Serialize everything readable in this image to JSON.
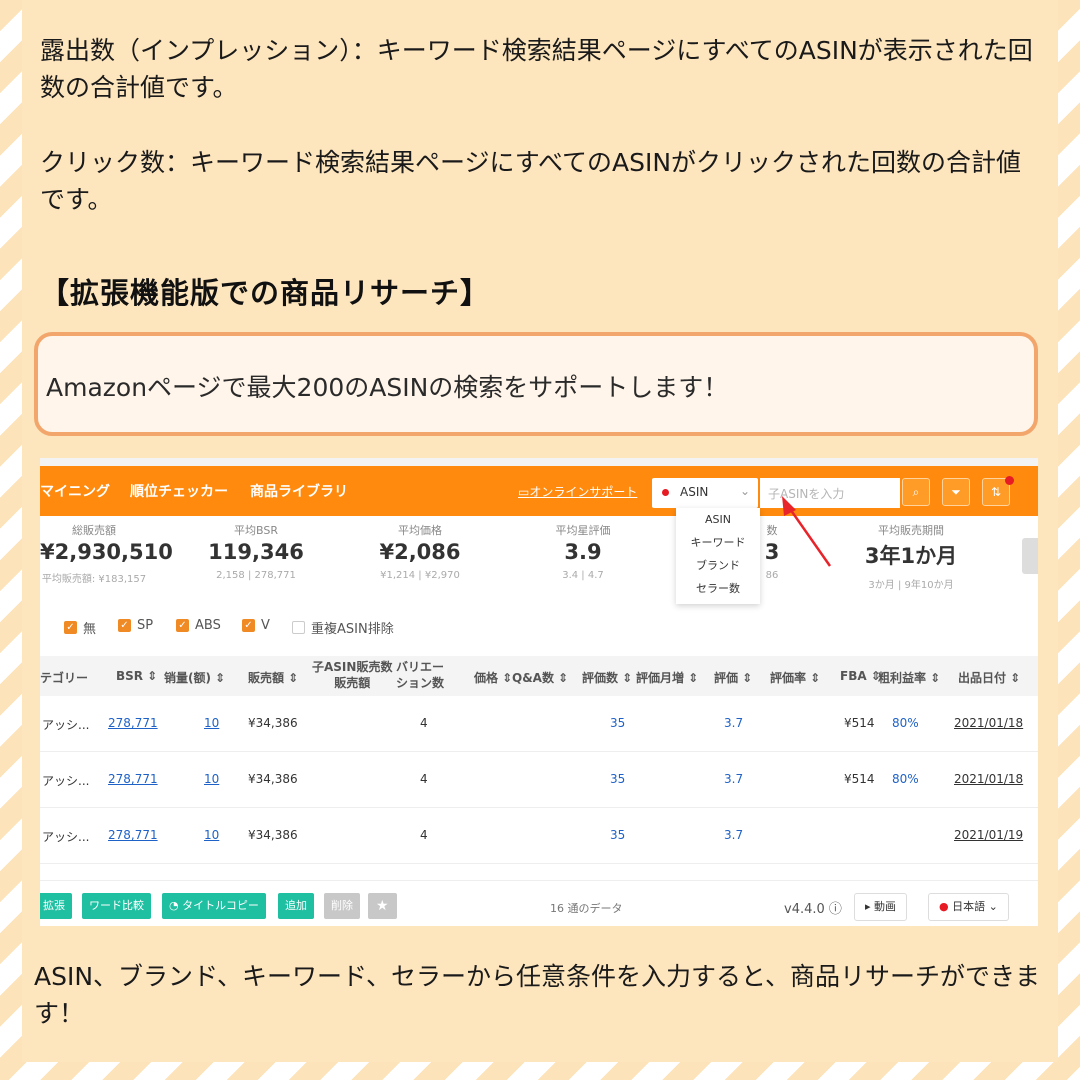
{
  "intro": {
    "impressions_text": "露出数（インプレッション）：キーワード検索結果ページにすべてのASINが表示された回数の合計値です。",
    "clicks_text": "クリック数：キーワード検索結果ページにすべてのASINがクリックされた回数の合計値です。"
  },
  "section_heading": "【拡張機能版での商品リサーチ】",
  "callout_text": "Amazonページで最大200のASINの検索をサポートします！",
  "closing_text": "ASIN、ブランド、キーワード、セラーから任意条件を入力すると、商品リサーチができます！",
  "screenshot": {
    "nav": {
      "tabs": [
        "マイニング",
        "順位チェッカー",
        "商品ライブラリ"
      ],
      "support_link": "オンラインサポート",
      "search_type": "ASIN",
      "search_placeholder": "子ASINを入力",
      "dropdown_options": [
        "ASIN",
        "キーワード",
        "ブランド",
        "セラー数"
      ]
    },
    "stats": [
      {
        "label": "総販売額",
        "value": "¥2,930,510",
        "sub": "平均販売額: ¥183,157"
      },
      {
        "label": "平均BSR",
        "value": "119,346",
        "sub": "2,158 | 278,771"
      },
      {
        "label": "平均価格",
        "value": "¥2,086",
        "sub": "¥1,214 | ¥2,970"
      },
      {
        "label": "平均星評価",
        "value": "3.9",
        "sub": "3.4 | 4.7"
      },
      {
        "label": "数",
        "value": "3",
        "sub": "86"
      },
      {
        "label": "平均販売期間",
        "value": "3年1か月",
        "sub": "3か月 | 9年10か月"
      }
    ],
    "filters": {
      "checked": [
        "無",
        "SP",
        "ABS",
        "V"
      ],
      "unchecked": "重複ASIN排除"
    },
    "columns": {
      "category": "テゴリー",
      "bsr": "BSR",
      "sales_qty": "销量(额)",
      "sales_amount": "販売額",
      "child_asin_1": "子ASIN販売数",
      "child_asin_2": "販売額",
      "variation_1": "バリエー",
      "variation_2": "ション数",
      "price": "価格",
      "qa": "Q&A数",
      "review_count": "評価数",
      "review_monthly": "評価月増",
      "rating": "評価",
      "rating_rate": "評価率",
      "fba": "FBA",
      "margin": "粗利益率",
      "listing_date": "出品日付"
    },
    "rows": [
      {
        "category": "アッシ...",
        "bsr": "278,771",
        "sales": "10",
        "amount": "¥34,386",
        "variations": "4",
        "reviews": "35",
        "rating": "3.7",
        "fba": "¥514",
        "margin": "80%",
        "date": "2021/01/18"
      },
      {
        "category": "アッシ...",
        "bsr": "278,771",
        "sales": "10",
        "amount": "¥34,386",
        "variations": "4",
        "reviews": "35",
        "rating": "3.7",
        "fba": "¥514",
        "margin": "80%",
        "date": "2021/01/18"
      },
      {
        "category": "アッシ...",
        "bsr": "278,771",
        "sales": "10",
        "amount": "¥34,386",
        "variations": "4",
        "reviews": "35",
        "rating": "3.7",
        "fba": "",
        "margin": "",
        "date": "2021/01/19"
      }
    ],
    "footer": {
      "buttons": [
        "拡張",
        "ワード比較",
        "タイトルコピー",
        "追加",
        "削除"
      ],
      "data_count": "16 通のデータ",
      "version": "v4.4.0",
      "video_label": "動画",
      "language": "日本語"
    }
  },
  "colors": {
    "nav_orange": "#ff8a0d",
    "link_blue": "#1f62c7",
    "teal_button": "#1fbfa2",
    "callout_border": "#f2a66b",
    "panel_bg": "#fde5be"
  }
}
